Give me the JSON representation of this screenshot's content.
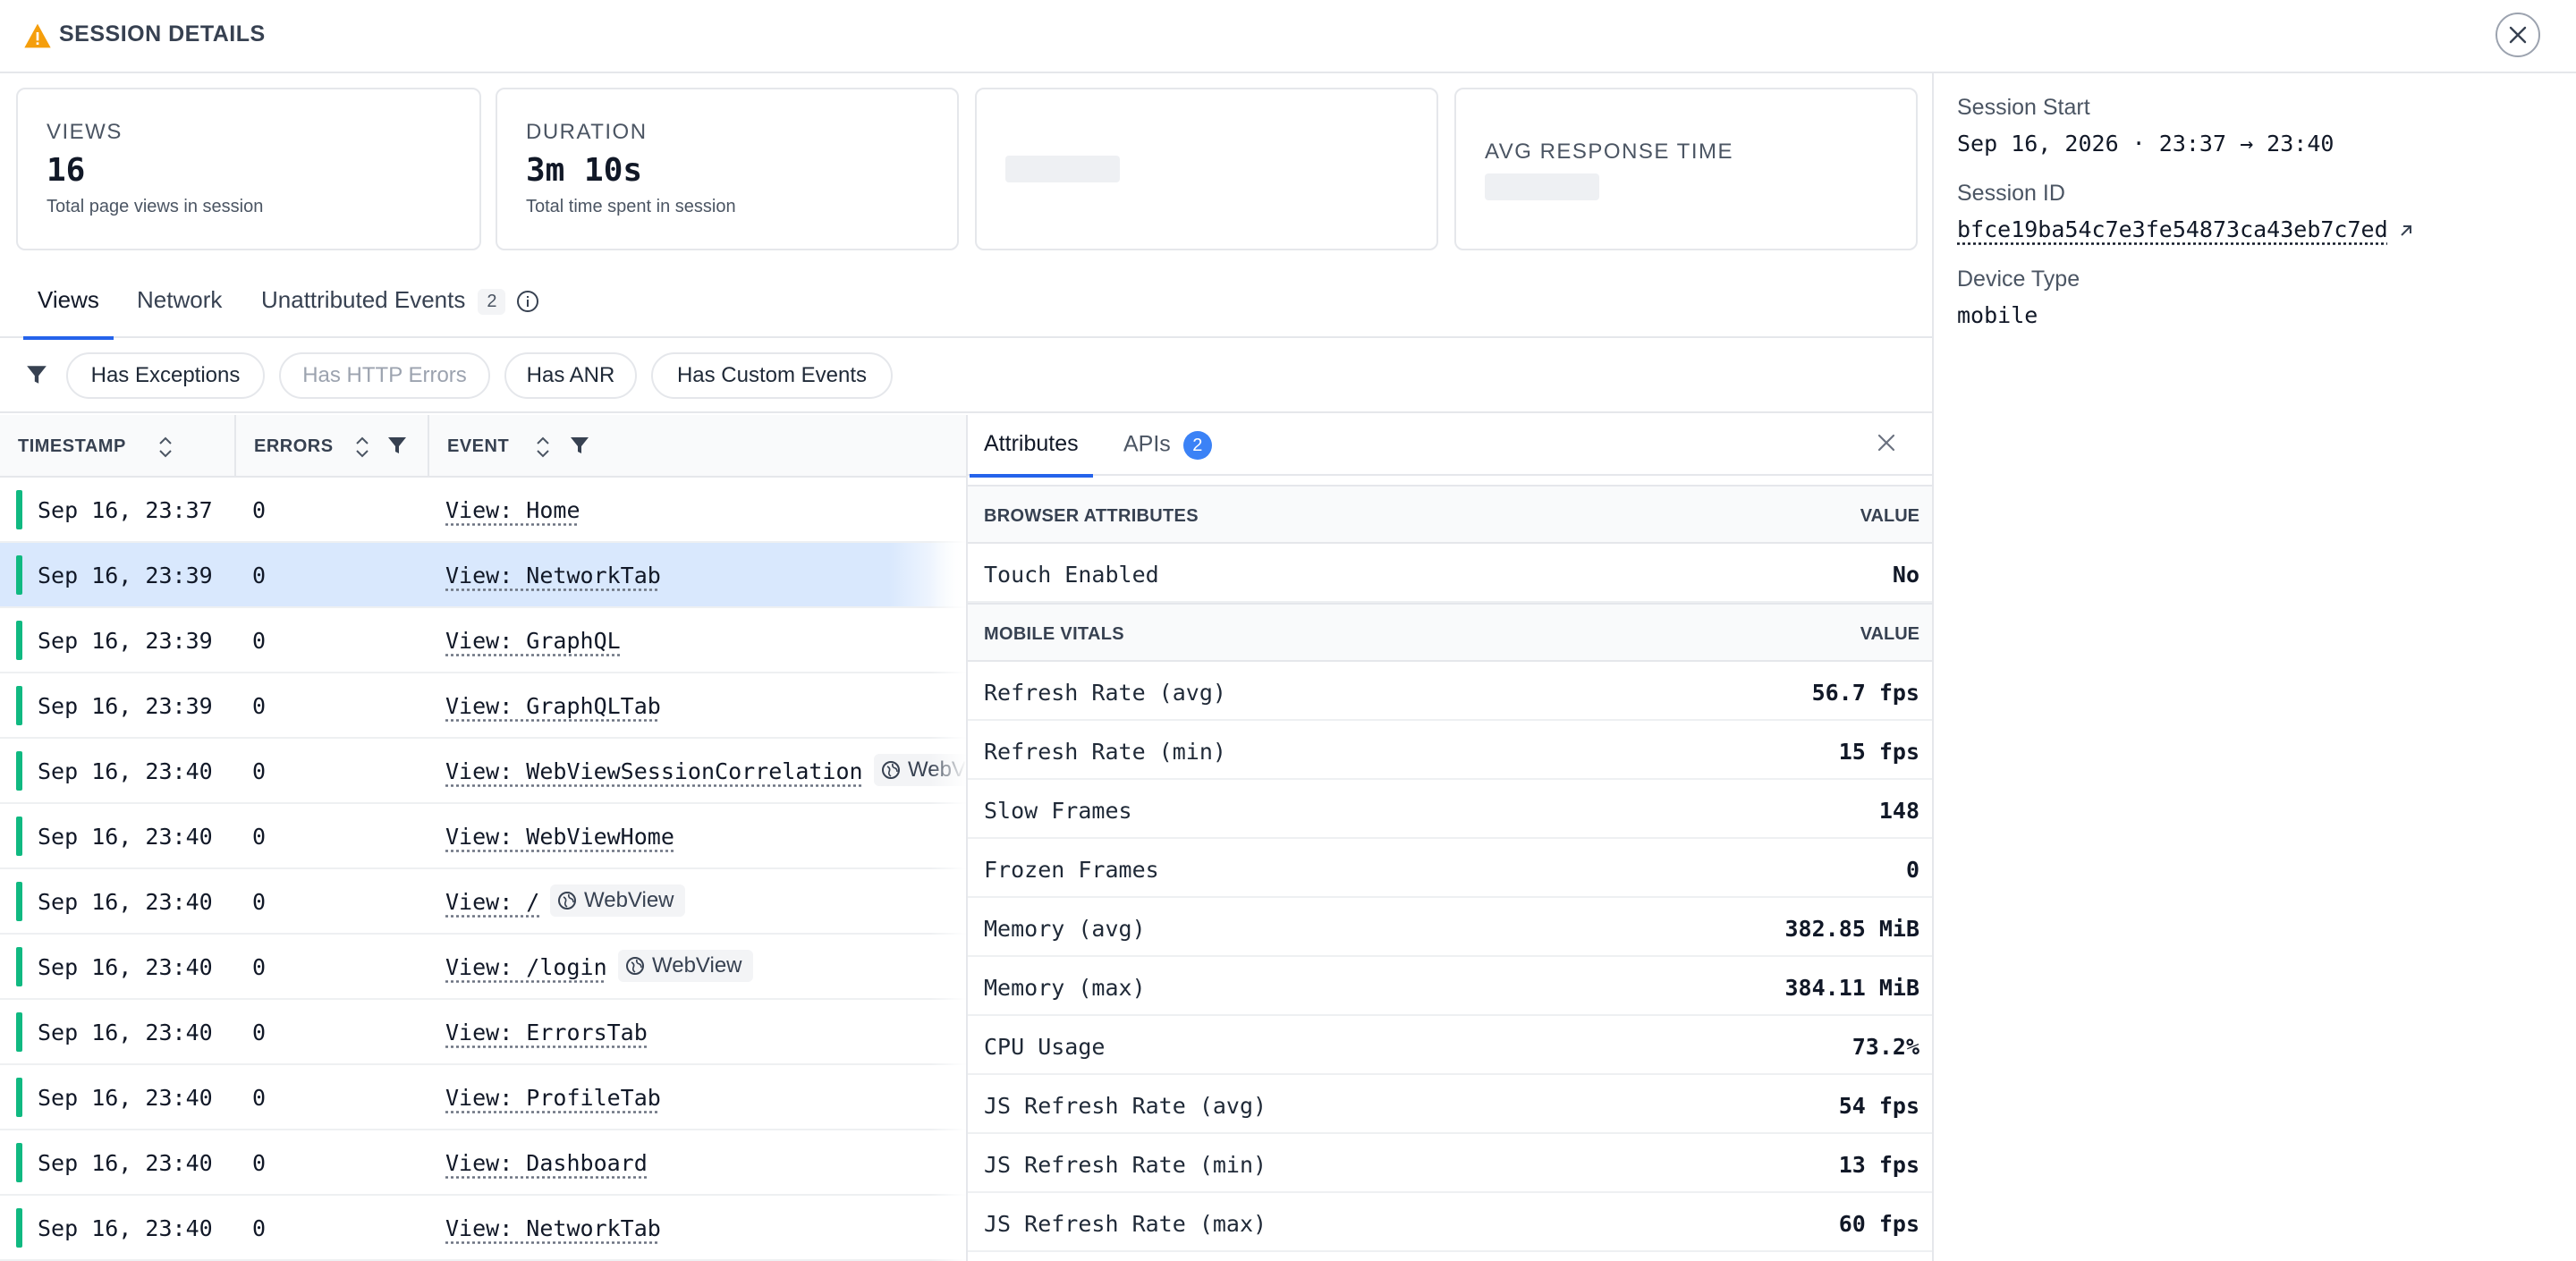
{
  "header": {
    "title": "SESSION DETAILS",
    "warning_color": "#f59e0b"
  },
  "metrics": [
    {
      "title": "VIEWS",
      "value": "16",
      "subtitle": "Total page views in session"
    },
    {
      "title": "DURATION",
      "value": "3m 10s",
      "subtitle": "Total time spent in session"
    },
    {
      "title": "",
      "value": "",
      "subtitle": ""
    },
    {
      "title": "AVG RESPONSE TIME",
      "value": "",
      "subtitle": ""
    }
  ],
  "session": {
    "start_label": "Session Start",
    "start_value": "Sep 16, 2026 · 23:37 → 23:40",
    "id_label": "Session ID",
    "id_value": "bfce19ba54c7e3fe54873ca43eb7c7ed",
    "device_label": "Device Type",
    "device_value": "mobile"
  },
  "tabs": [
    {
      "label": "Views",
      "active": true
    },
    {
      "label": "Network",
      "active": false
    },
    {
      "label": "Unattributed Events",
      "badge": "2",
      "active": false
    }
  ],
  "filters": [
    {
      "label": "Has Exceptions",
      "disabled": false
    },
    {
      "label": "Has HTTP Errors",
      "disabled": true
    },
    {
      "label": "Has ANR",
      "disabled": false
    },
    {
      "label": "Has Custom Events",
      "disabled": false
    }
  ],
  "table": {
    "columns": [
      "TIMESTAMP",
      "ERRORS",
      "EVENT"
    ],
    "rows": [
      {
        "timestamp": "Sep 16, 23:37",
        "errors": "0",
        "event": "View: Home"
      },
      {
        "timestamp": "Sep 16, 23:39",
        "errors": "0",
        "event": "View: NetworkTab",
        "selected": true
      },
      {
        "timestamp": "Sep 16, 23:39",
        "errors": "0",
        "event": "View: GraphQL"
      },
      {
        "timestamp": "Sep 16, 23:39",
        "errors": "0",
        "event": "View: GraphQLTab"
      },
      {
        "timestamp": "Sep 16, 23:40",
        "errors": "0",
        "event": "View: WebViewSessionCorrelation",
        "tag": "WebVi"
      },
      {
        "timestamp": "Sep 16, 23:40",
        "errors": "0",
        "event": "View: WebViewHome"
      },
      {
        "timestamp": "Sep 16, 23:40",
        "errors": "0",
        "event": "View: /",
        "tag": "WebView"
      },
      {
        "timestamp": "Sep 16, 23:40",
        "errors": "0",
        "event": "View: /login",
        "tag": "WebView"
      },
      {
        "timestamp": "Sep 16, 23:40",
        "errors": "0",
        "event": "View: ErrorsTab"
      },
      {
        "timestamp": "Sep 16, 23:40",
        "errors": "0",
        "event": "View: ProfileTab"
      },
      {
        "timestamp": "Sep 16, 23:40",
        "errors": "0",
        "event": "View: Dashboard"
      },
      {
        "timestamp": "Sep 16, 23:40",
        "errors": "0",
        "event": "View: NetworkTab"
      }
    ],
    "status_color": "#10b981"
  },
  "attributes_panel": {
    "tabs": [
      {
        "label": "Attributes",
        "active": true
      },
      {
        "label": "APIs",
        "badge": "2"
      }
    ],
    "sections": [
      {
        "title": "BROWSER ATTRIBUTES",
        "value_header": "VALUE",
        "rows": [
          {
            "key": "Touch Enabled",
            "value": "No"
          }
        ]
      },
      {
        "title": "MOBILE VITALS",
        "value_header": "VALUE",
        "rows": [
          {
            "key": "Refresh Rate (avg)",
            "value": "56.7 fps"
          },
          {
            "key": "Refresh Rate (min)",
            "value": "15 fps"
          },
          {
            "key": "Slow Frames",
            "value": "148"
          },
          {
            "key": "Frozen Frames",
            "value": "0"
          },
          {
            "key": "Memory (avg)",
            "value": "382.85 MiB"
          },
          {
            "key": "Memory (max)",
            "value": "384.11 MiB"
          },
          {
            "key": "CPU Usage",
            "value": "73.2%"
          },
          {
            "key": "JS Refresh Rate (avg)",
            "value": "54 fps"
          },
          {
            "key": "JS Refresh Rate (min)",
            "value": "13 fps"
          },
          {
            "key": "JS Refresh Rate (max)",
            "value": "60 fps"
          }
        ]
      }
    ]
  }
}
